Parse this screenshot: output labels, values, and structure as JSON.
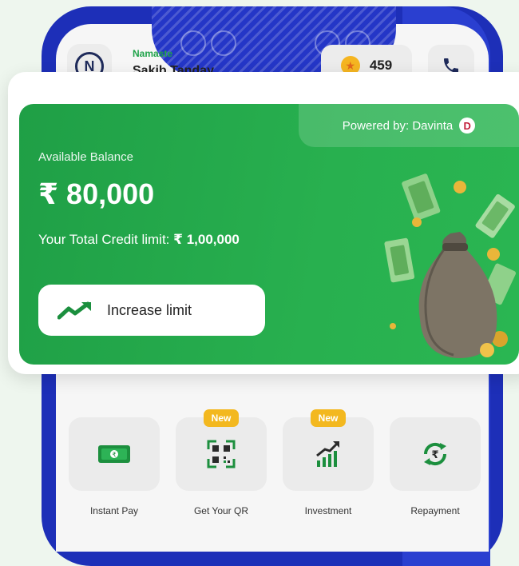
{
  "header": {
    "greeting": "Namaste",
    "user_name": "Sakib Tanday",
    "coins": "459"
  },
  "balance_card": {
    "powered_by": "Powered by: Davinta",
    "available_label": "Available Balance",
    "amount": "₹ 80,000",
    "credit_label": "Your Total Credit limit: ",
    "credit_value": "₹ 1,00,000",
    "increase_button": "Increase limit"
  },
  "quick_actions": [
    {
      "label": "Instant Pay",
      "icon": "banknote-icon",
      "badge": ""
    },
    {
      "label": "Get Your QR",
      "icon": "qr-code-icon",
      "badge": "New"
    },
    {
      "label": "Investment",
      "icon": "growth-chart-icon",
      "badge": "New"
    },
    {
      "label": "Repayment",
      "icon": "rupee-refresh-icon",
      "badge": ""
    }
  ],
  "colors": {
    "phone_frame": "#1d2fb8",
    "card_green": "#22a84b",
    "badge_yellow": "#f3b81f"
  }
}
